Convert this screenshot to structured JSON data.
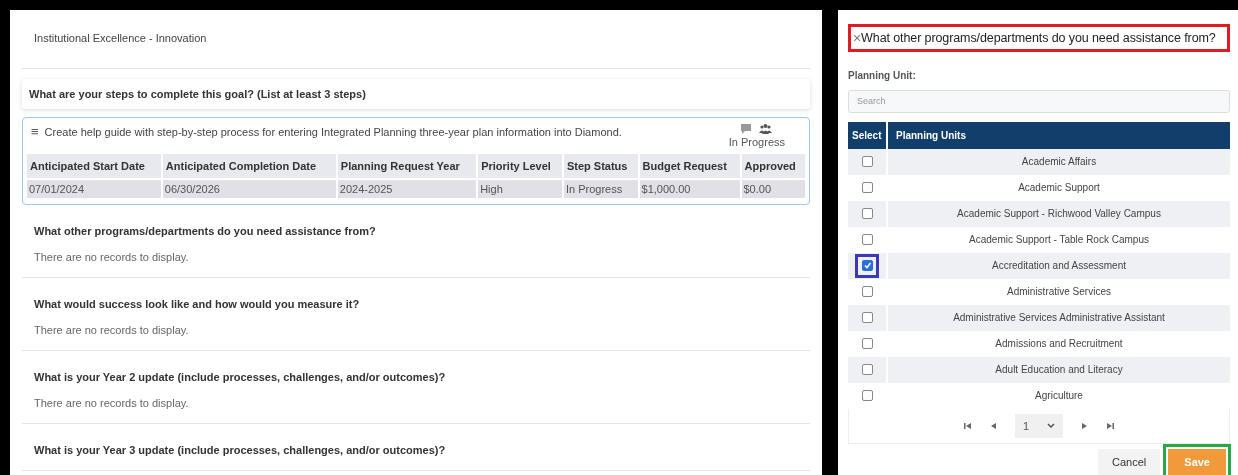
{
  "goal": {
    "text": "Institutional Excellence - Innovation"
  },
  "steps_heading": "What are your steps to complete this goal? (List at least 3 steps)",
  "step": {
    "menu_icon": "≡",
    "description": "Create help guide with step-by-step process for entering Integrated Planning three-year plan information into Diamond.",
    "status": "In Progress",
    "columns": [
      "Anticipated Start Date",
      "Anticipated Completion Date",
      "Planning Request Year",
      "Priority Level",
      "Step Status",
      "Budget Request",
      "Approved"
    ],
    "rows": [
      [
        "07/01/2024",
        "06/30/2026",
        "2024-2025",
        "High",
        "In Progress",
        "$1,000.00",
        "$0.00"
      ]
    ]
  },
  "sections": [
    {
      "question": "What other programs/departments do you need assistance from?",
      "empty_text": "There are no records to display."
    },
    {
      "question": "What would success look like and how would you measure it?",
      "empty_text": "There are no records to display."
    },
    {
      "question": "What is your Year 2 update (include processes, challenges, and/or outcomes)?",
      "empty_text": "There are no records to display."
    },
    {
      "question": "What is your Year 3 update (include processes, challenges, and/or outcomes)?"
    }
  ],
  "dialog": {
    "close": "×",
    "title": "What other programs/departments do you need assistance from?",
    "field_label": "Planning Unit:",
    "search": {
      "placeholder": "Search"
    },
    "columns": [
      "Select",
      "Planning Units"
    ],
    "units": [
      {
        "name": "Academic Affairs",
        "checked": false
      },
      {
        "name": "Academic Support",
        "checked": false
      },
      {
        "name": "Academic Support - Richwood Valley Campus",
        "checked": false
      },
      {
        "name": "Academic Support - Table Rock Campus",
        "checked": false
      },
      {
        "name": "Accreditation and Assessment",
        "checked": true
      },
      {
        "name": "Administrative Services",
        "checked": false
      },
      {
        "name": "Administrative Services Administrative Assistant",
        "checked": false
      },
      {
        "name": "Admissions and Recruitment",
        "checked": false
      },
      {
        "name": "Adult Education and Literacy",
        "checked": false
      },
      {
        "name": "Agriculture",
        "checked": false
      }
    ],
    "pager": {
      "page": "1"
    },
    "buttons": [
      {
        "label": "Cancel",
        "kind": "secondary"
      },
      {
        "label": "Save",
        "kind": "primary"
      }
    ]
  }
}
